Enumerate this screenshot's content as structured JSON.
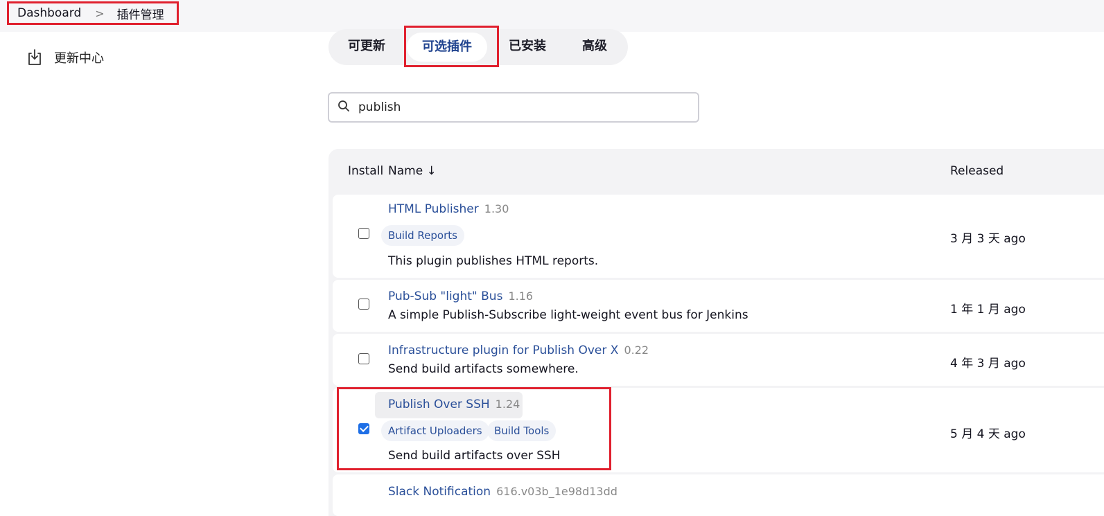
{
  "breadcrumb": {
    "root": "Dashboard",
    "separator": ">",
    "current": "插件管理"
  },
  "sidebar": {
    "items": [
      {
        "label": "更新中心",
        "icon": "download-icon"
      }
    ]
  },
  "tabs": [
    {
      "label": "可更新",
      "active": false
    },
    {
      "label": "可选插件",
      "active": true
    },
    {
      "label": "已安装",
      "active": false
    },
    {
      "label": "高级",
      "active": false
    }
  ],
  "search": {
    "value": "publish",
    "icon": "search-icon"
  },
  "table": {
    "headers": {
      "install": "Install",
      "name": "Name ↓",
      "released": "Released"
    },
    "rows": [
      {
        "name": "HTML Publisher",
        "version": "1.30",
        "tags": [
          "Build Reports"
        ],
        "description": "This plugin publishes HTML reports.",
        "released": "3 月 3 天 ago",
        "checked": false
      },
      {
        "name": "Pub-Sub \"light\" Bus",
        "version": "1.16",
        "tags": [],
        "description": "A simple Publish-Subscribe light-weight event bus for Jenkins",
        "released": "1 年 1 月 ago",
        "checked": false
      },
      {
        "name": "Infrastructure plugin for Publish Over X",
        "version": "0.22",
        "tags": [],
        "description": "Send build artifacts somewhere.",
        "released": "4 年 3 月 ago",
        "checked": false
      },
      {
        "name": "Publish Over SSH",
        "version": "1.24",
        "tags": [
          "Artifact Uploaders",
          "Build Tools"
        ],
        "description": "Send build artifacts over SSH",
        "released": "5 月 4 天 ago",
        "checked": true
      },
      {
        "name": "Slack Notification",
        "version": "616.v03b_1e98d13dd",
        "tags": [],
        "description": "",
        "released": "",
        "checked": false
      }
    ]
  },
  "colors": {
    "highlight": "#e0202e",
    "link": "#2a4f99",
    "checkbox": "#1e6fe6"
  }
}
